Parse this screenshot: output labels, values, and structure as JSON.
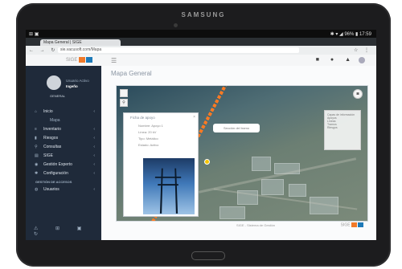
{
  "device": {
    "brand": "SAMSUNG"
  },
  "statusbar": {
    "left_icons": "⊞ ▣",
    "right_icons": "✱ ▾ ◢ 96% ▮ 17:59"
  },
  "browser": {
    "tab_title": "Mapa General | SIGE",
    "nav_icons": "← → ↻",
    "url": "sie.vacusoft.com/Mapa",
    "toolbar_actions": "☆ ⋮"
  },
  "app": {
    "logo_text": "SIGE",
    "header_icons": "■ ● ▲"
  },
  "sidebar": {
    "user_name": "Usuario Activo",
    "user_sub": "Ingeño",
    "user_role": "GENERAL",
    "items": [
      {
        "label": "Inicio",
        "icon": "home-icon",
        "glyph": "⌂",
        "chevron": true
      },
      {
        "label": "Mapa",
        "icon": "",
        "glyph": "",
        "chevron": false,
        "sub": true
      },
      {
        "label": "Inventario",
        "icon": "list-icon",
        "glyph": "≡",
        "chevron": true
      },
      {
        "label": "Riesgos",
        "icon": "chart-icon",
        "glyph": "▮",
        "chevron": true
      },
      {
        "label": "Consultas",
        "icon": "search-icon",
        "glyph": "⚲",
        "chevron": true
      },
      {
        "label": "SIGE",
        "icon": "database-icon",
        "glyph": "▤",
        "chevron": true
      },
      {
        "label": "Gestión Experto",
        "icon": "user-icon",
        "glyph": "◉",
        "chevron": true
      },
      {
        "label": "Configuración",
        "icon": "gear-icon",
        "glyph": "✱",
        "chevron": true
      }
    ],
    "section_label": "GESTIÓN DE ACCESOS",
    "extra_item": {
      "label": "Usuarios",
      "icon": "users-icon",
      "glyph": "◍"
    },
    "footer_icons": "⚠ ⊞ ▣ ↻"
  },
  "main": {
    "page_title": "Mapa General",
    "info_panel_title": "Ficha de apoyo",
    "info_rows": [
      "Nombre: Apoyo 1",
      "Línea: 20 kV",
      "Tipo: Metálico",
      "Estado: Activo"
    ],
    "tooltip": "Sección del tramo",
    "layers_title": "Capas de información",
    "layers": [
      "Apoyos",
      "Líneas",
      "Tramos",
      "Riesgos"
    ],
    "footer_text": "SIGE - Sistema de Gestión",
    "footer_logo": "SIGE"
  },
  "colors": {
    "sidebar_bg": "#1f2a3a",
    "route": "#ff7a22",
    "logo_orange": "#f07a2a",
    "logo_blue": "#1e7ab8"
  }
}
